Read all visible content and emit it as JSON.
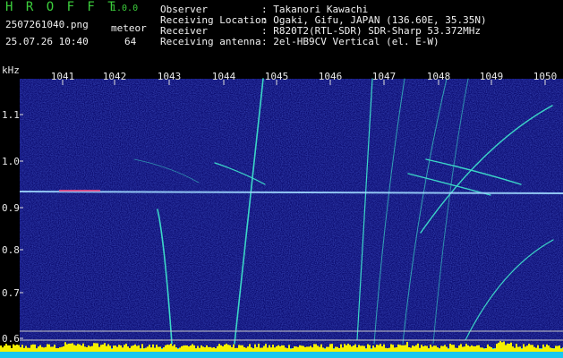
{
  "header": {
    "title": "H R O F F T",
    "version": "1.0.0",
    "filename": "2507261040.png",
    "meteor_label": "meteor",
    "datetime": "25.07.26 10:40",
    "meteor_count": "64",
    "fields": [
      {
        "label": "Observer",
        "value": ": Takanori Kawachi"
      },
      {
        "label": "Receiving Location",
        "value": ": Ogaki, Gifu, JAPAN (136.60E, 35.35N)"
      },
      {
        "label": "Receiver",
        "value": ": R820T2(RTL-SDR) SDR-Sharp 53.372MHz"
      },
      {
        "label": "Receiving antenna",
        "value": ": 2el-HB9CV Vertical (el. E-W)"
      }
    ]
  },
  "axis": {
    "unit": "kHz",
    "y_ticks": [
      "1.1",
      "1.0",
      "0.9",
      "0.8",
      "0.7",
      "0.6"
    ],
    "x_ticks": [
      "1041",
      "1042",
      "1043",
      "1044",
      "1045",
      "1046",
      "1047",
      "1048",
      "1049",
      "1050"
    ]
  },
  "colors": {
    "header_text": "#3ccf3c",
    "spectrogram_bg": "#0a0a6e",
    "trace": "#3cd7c8",
    "carrier": "#9fd8ff",
    "level_bar": "#f5f000",
    "level_base": "#18c8f0"
  }
}
